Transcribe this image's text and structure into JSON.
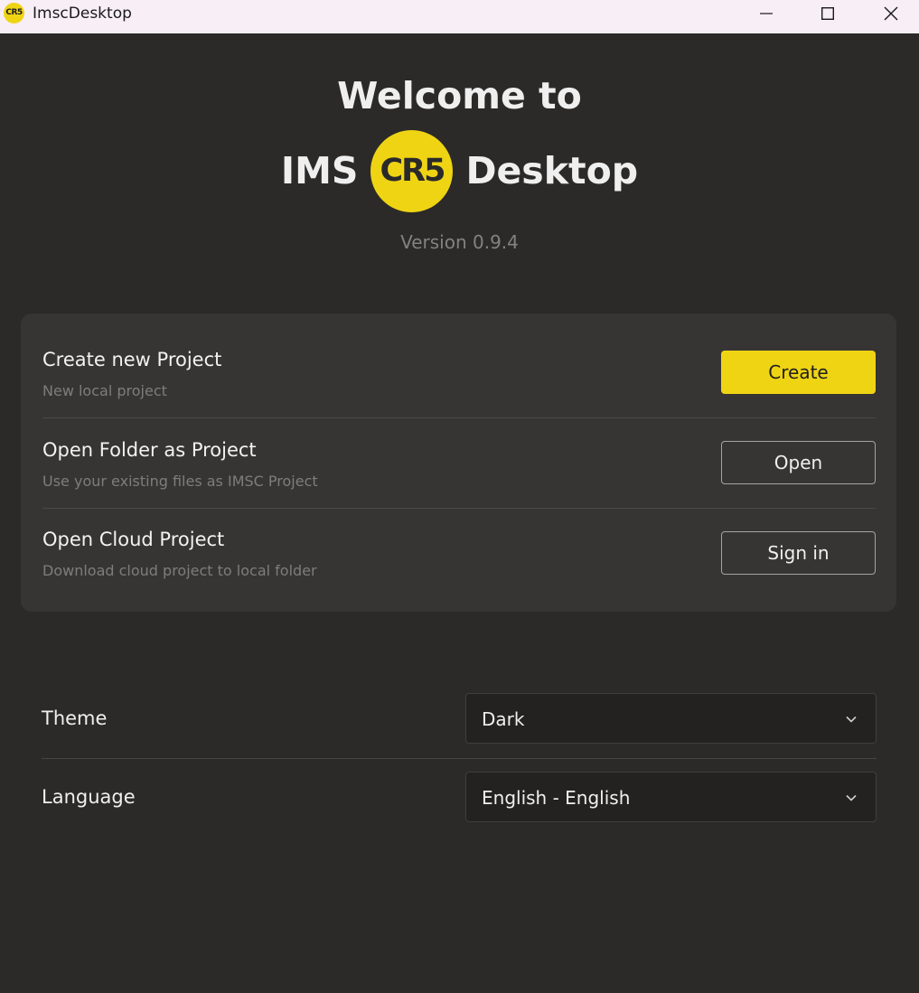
{
  "window": {
    "title": "ImscDesktop",
    "icon_text": "CR5",
    "controls": [
      "minimize-icon",
      "maximize-icon",
      "close-icon"
    ]
  },
  "hero": {
    "line1": "Welcome to",
    "brand_left": "IMS",
    "logo_text": "CR5",
    "brand_right": "Desktop",
    "version": "Version 0.9.4"
  },
  "actions": [
    {
      "title": "Create new Project",
      "subtitle": "New local project",
      "button": "Create"
    },
    {
      "title": "Open Folder as Project",
      "subtitle": "Use your existing files as IMSC Project",
      "button": "Open"
    },
    {
      "title": "Open Cloud Project",
      "subtitle": "Download cloud project to local folder",
      "button": "Sign in"
    }
  ],
  "settings": {
    "theme": {
      "label": "Theme",
      "value": "Dark"
    },
    "language": {
      "label": "Language",
      "value": "English - English"
    }
  },
  "colors": {
    "accent": "#efd414",
    "background": "#2b2a28",
    "card": "#363533",
    "titlebar": "#f8eef6"
  }
}
